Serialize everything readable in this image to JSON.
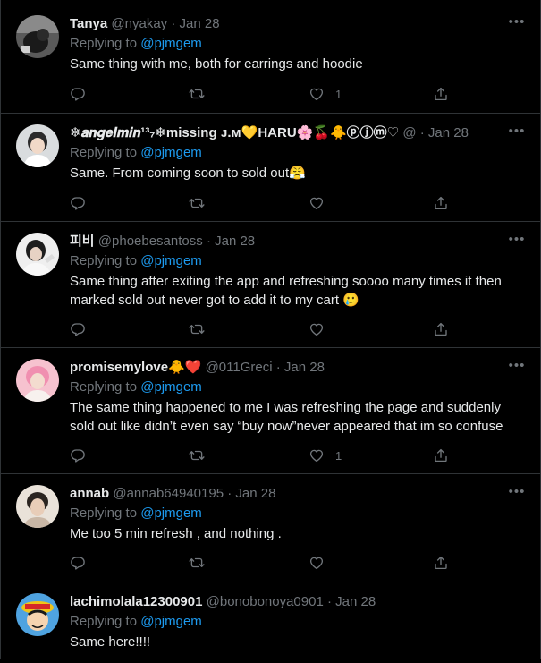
{
  "tweets": [
    {
      "name": "Tanya",
      "handle": "@nyakay",
      "dot": "·",
      "time": "Jan 28",
      "replying_label": "Replying to",
      "replying_to": "@pjmgem",
      "text": "Same thing with me, both for earrings and hoodie",
      "like_count": "1",
      "avatar_color": "#4a4a4a"
    },
    {
      "name": "❄𝒂𝒏𝒈𝒆𝒍𝒎𝒊𝒏¹³₇❄missing ᴊ.ᴍ💛HARU🌸🍒🐥ⓟⓙⓜ♡",
      "handle": "@",
      "dot": "·",
      "time": "Jan 28",
      "replying_label": "Replying to",
      "replying_to": "@pjmgem",
      "text": "Same. From coming soon to sold out😤",
      "like_count": "",
      "avatar_color": "#cfd3d6"
    },
    {
      "name": "피비",
      "handle": "@phoebesantoss",
      "dot": "·",
      "time": "Jan 28",
      "replying_label": "Replying to",
      "replying_to": "@pjmgem",
      "text": "Same thing after exiting the app and refreshing soooo many times it then marked sold out never got to add it to my cart 🥲",
      "like_count": "",
      "avatar_color": "#e6e6e6"
    },
    {
      "name": "promisemylove🐥❤️",
      "handle": "@011Greci",
      "dot": "·",
      "time": "Jan 28",
      "replying_label": "Replying to",
      "replying_to": "@pjmgem",
      "text": "The same thing happened to me I was refreshing the page and suddenly sold out like didn’t even say “buy now”never appeared that im so confuse",
      "like_count": "1",
      "avatar_color": "#f0a8b8"
    },
    {
      "name": "annab",
      "handle": "@annab64940195",
      "dot": "·",
      "time": "Jan 28",
      "replying_label": "Replying to",
      "replying_to": "@pjmgem",
      "text": "Me too 5 min refresh , and nothing .",
      "like_count": "",
      "avatar_color": "#d8cbbd"
    },
    {
      "name": "lachimolala12300901",
      "handle": "@bonobonoya0901",
      "dot": "·",
      "time": "Jan 28",
      "replying_label": "Replying to",
      "replying_to": "@pjmgem",
      "text": "Same here!!!!",
      "like_count": "",
      "avatar_color": "#3b8ad1"
    }
  ],
  "icons": {
    "more": "more-horizontal-icon",
    "reply": "reply-icon",
    "retweet": "retweet-icon",
    "like": "heart-icon",
    "share": "share-icon"
  },
  "colors": {
    "background": "#000000",
    "text": "#e7e9ea",
    "secondary": "#71767b",
    "link": "#1d9bf0",
    "border": "#2f3336"
  }
}
